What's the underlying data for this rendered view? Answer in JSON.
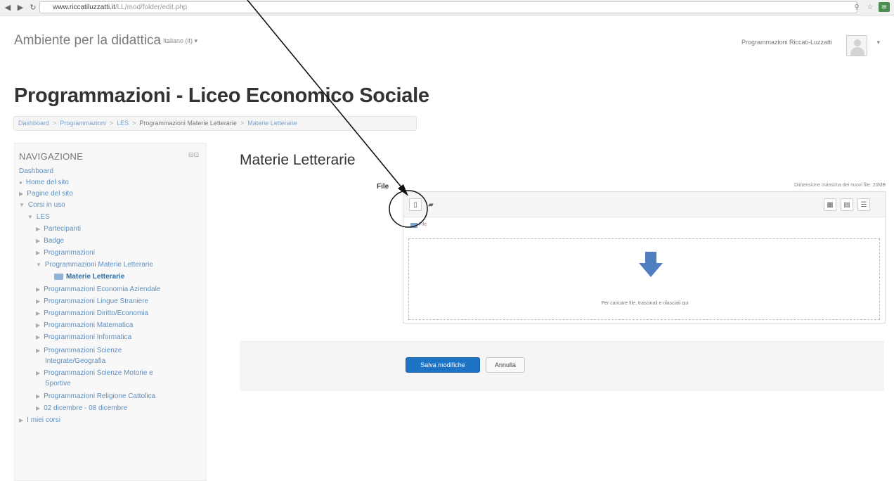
{
  "browser": {
    "back_icon": "back-arrow-icon",
    "forward_icon": "forward-arrow-icon",
    "reload_icon": "reload-icon",
    "url_host": "www.riccatiluzzatti.it",
    "url_path": "/LL/mod/folder/edit.php",
    "bookmark_icon": "star-icon",
    "menu_icon": "menu-icon"
  },
  "navbar": {
    "brand": "Ambiente per la didattica",
    "language": "Italiano (it) ▾",
    "user_name": "Programmazioni Riccati-Luzzatti",
    "user_caret": "▾"
  },
  "page": {
    "title": "Programmazioni - Liceo Economico Sociale",
    "breadcrumb": [
      "Dashboard",
      "Programmazioni",
      "LES",
      "Programmazioni Materie Letterarie",
      "Materie Letterarie"
    ]
  },
  "navigation": {
    "title": "NAVIGAZIONE",
    "tools": "⊟⊡",
    "items": [
      {
        "label": "Dashboard",
        "arrow": ""
      },
      {
        "label": "Home del sito",
        "arrow": "●"
      },
      {
        "label": "Pagine del sito",
        "arrow": "▶"
      },
      {
        "label": "Corsi in uso",
        "arrow": "▼"
      },
      {
        "label": "LES",
        "arrow": "▼"
      },
      {
        "label": "Partecipanti",
        "arrow": "▶"
      },
      {
        "label": "Badge",
        "arrow": "▶"
      },
      {
        "label": "Programmazioni",
        "arrow": "▶"
      },
      {
        "label": "Programmazioni Materie Letterarie",
        "arrow": "▼"
      },
      {
        "label": "Materie Letterarie",
        "arrow": ""
      },
      {
        "label": "Programmazioni Economia Aziendale",
        "arrow": "▶"
      },
      {
        "label": "Programmazioni Lingue Straniere",
        "arrow": "▶"
      },
      {
        "label": "Programmazioni Diritto/Economia",
        "arrow": "▶"
      },
      {
        "label": "Programmazioni Matematica",
        "arrow": "▶"
      },
      {
        "label": "Programmazioni Informatica",
        "arrow": "▶"
      },
      {
        "label": "Programmazioni Scienze",
        "arrow": "▶"
      },
      {
        "label": "Integrate/Geografia",
        "arrow": ""
      },
      {
        "label": "Programmazioni Scienze Motorie e",
        "arrow": "▶"
      },
      {
        "label": "Sportive",
        "arrow": ""
      },
      {
        "label": "Programmazioni Religione Cattolica",
        "arrow": "▶"
      },
      {
        "label": "02 dicembre - 08 dicembre",
        "arrow": "▶"
      },
      {
        "label": "I miei corsi",
        "arrow": "▶"
      }
    ]
  },
  "main": {
    "heading": "Materie Letterarie",
    "file_label": "File",
    "max_size": "Dimensione massima dei nuovi file: 20MB",
    "path_label": "File",
    "drop_text": "Per caricare file, trascinali e rilasciali qui",
    "save_label": "Salva modifiche",
    "cancel_label": "Annulla"
  },
  "colors": {
    "link": "#5e8fbf",
    "primary_button": "#1d73c4",
    "drop_arrow": "#4f7fc1"
  }
}
